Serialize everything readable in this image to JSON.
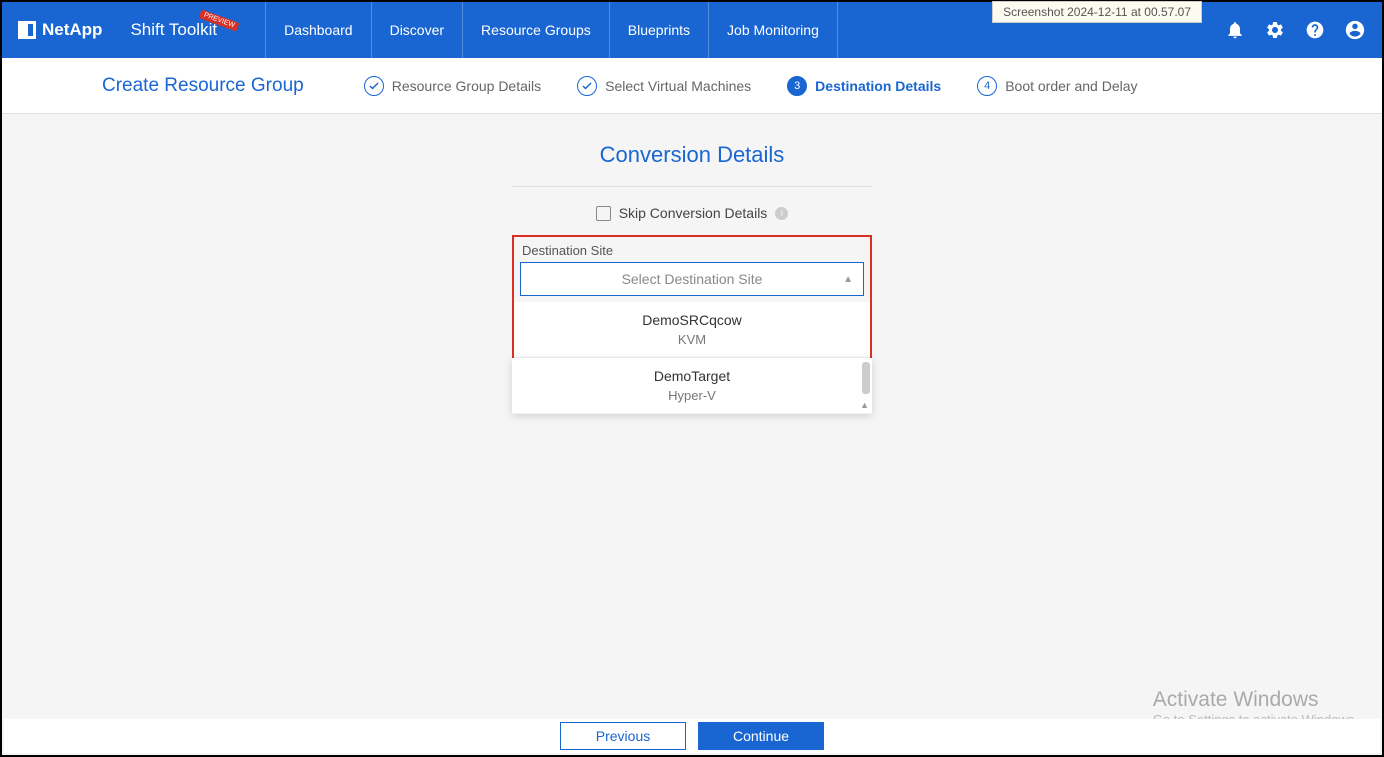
{
  "tooltip": "Screenshot 2024-12-11 at 00.57.07",
  "brand": "NetApp",
  "app_name": "Shift Toolkit",
  "preview_tag": "PREVIEW",
  "nav": {
    "dashboard": "Dashboard",
    "discover": "Discover",
    "resource_groups": "Resource Groups",
    "blueprints": "Blueprints",
    "job_monitoring": "Job Monitoring"
  },
  "page_title": "Create Resource Group",
  "steps": {
    "s1": "Resource Group Details",
    "s2": "Select Virtual Machines",
    "s3": "Destination Details",
    "s4": "Boot order and Delay",
    "n3": "3",
    "n4": "4"
  },
  "section_title": "Conversion Details",
  "skip_label": "Skip Conversion Details",
  "field_label": "Destination Site",
  "select_placeholder": "Select Destination Site",
  "options": [
    {
      "name": "DemoSRCqcow",
      "type": "KVM"
    },
    {
      "name": "DemoTarget",
      "type": "Hyper-V"
    }
  ],
  "buttons": {
    "previous": "Previous",
    "continue": "Continue"
  },
  "watermark": {
    "title": "Activate Windows",
    "sub": "Go to Settings to activate Windows."
  }
}
